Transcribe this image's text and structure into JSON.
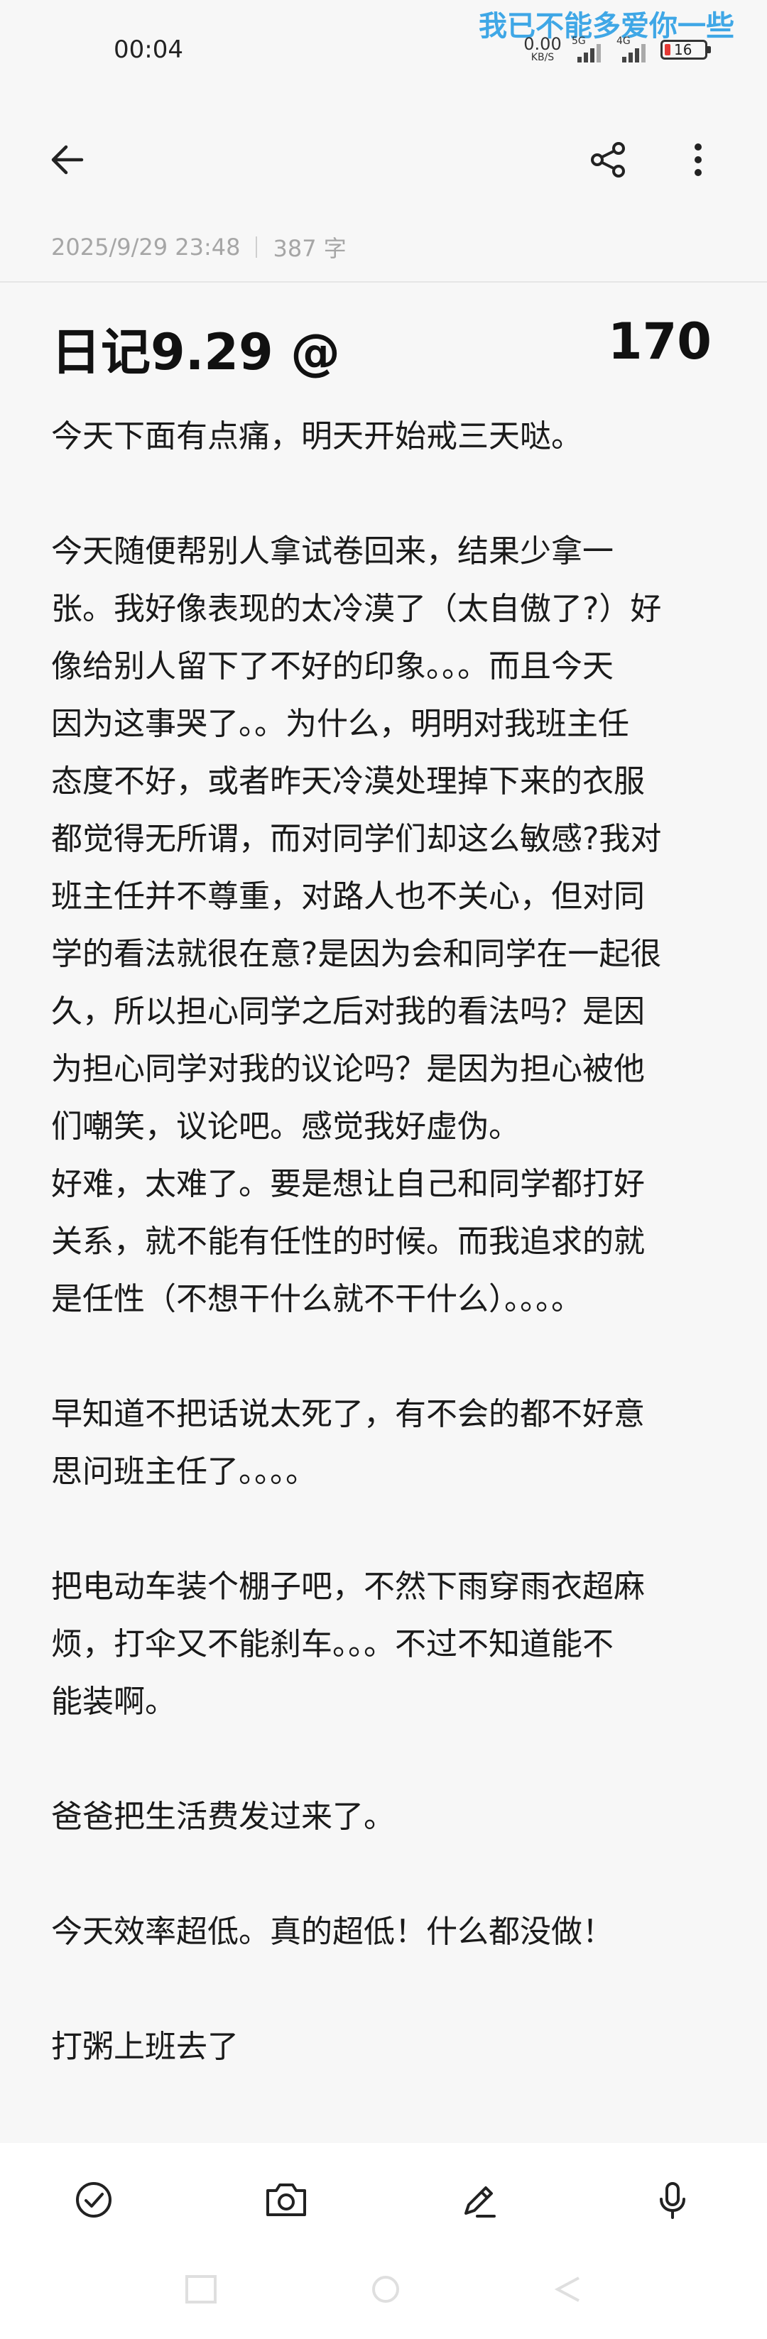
{
  "status_bar": {
    "time": "00:04",
    "watermark": "我已不能多爱你一些",
    "net_speed_value": "0.00",
    "net_speed_unit": "KB/S",
    "signal1_label": "5G",
    "signal2_label": "4G",
    "battery_level": "16",
    "battery_color": "#e53935"
  },
  "top_bar": {
    "back_icon": "arrow-left-icon",
    "share_icon": "share-icon",
    "more_icon": "more-vertical-icon"
  },
  "note": {
    "date": "2025/9/29 23:48",
    "word_count": "387 字",
    "title": "日记9.29 @",
    "title_number": "170",
    "lines": [
      "今天下面有点痛，明天开始戒三天哒。",
      "",
      "今天随便帮别人拿试卷回来，结果少拿一",
      "张。我好像表现的太冷漠了（太自傲了?）好",
      "像给别人留下了不好的印象。。。而且今天",
      "因为这事哭了。。为什么，明明对我班主任",
      "态度不好，或者昨天冷漠处理掉下来的衣服",
      "都觉得无所谓，而对同学们却这么敏感?我对",
      "班主任并不尊重，对路人也不关心，但对同",
      "学的看法就很在意?是因为会和同学在一起很",
      "久，所以担心同学之后对我的看法吗？是因",
      "为担心同学对我的议论吗？是因为担心被他",
      "们嘲笑，议论吧。感觉我好虚伪。",
      "好难，太难了。要是想让自己和同学都打好",
      "关系，就不能有任性的时候。而我追求的就",
      "是任性（不想干什么就不干什么）。。。。",
      "",
      "早知道不把话说太死了，有不会的都不好意",
      "思问班主任了。。。。",
      "",
      "把电动车装个棚子吧，不然下雨穿雨衣超麻",
      "烦，打伞又不能刹车。。。不过不知道能不",
      "能装啊。",
      "",
      "爸爸把生活费发过来了。",
      "",
      "今天效率超低。真的超低！什么都没做！",
      "",
      "打粥上班去了"
    ]
  },
  "toolbar": {
    "checklist_icon": "checklist-icon",
    "camera_icon": "camera-icon",
    "pen_icon": "pen-icon",
    "mic_icon": "microphone-icon"
  }
}
